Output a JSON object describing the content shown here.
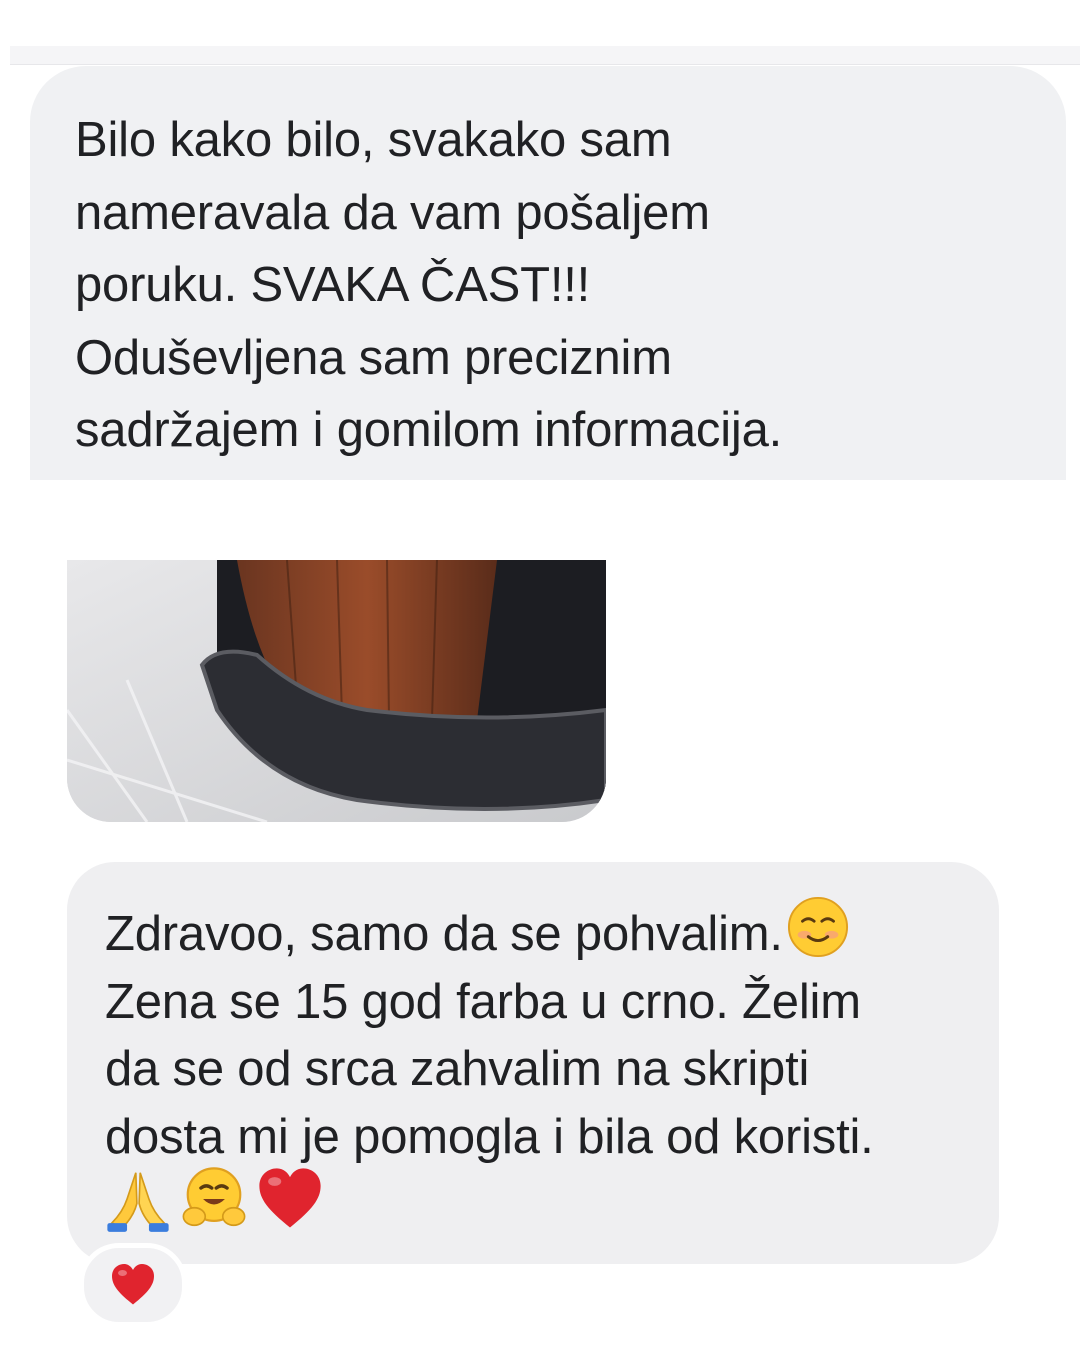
{
  "messages": [
    {
      "lines": [
        "Bilo kako bilo, svakako sam",
        "nameravala da vam pošaljem",
        "poruku. SVAKA ČAST!!!",
        "Oduševljena sam preciznim",
        "sadržajem i gomilom informacija."
      ]
    },
    {
      "lines": [
        "Zdravoo, samo da se pohvalim.",
        "Zena se 15 god farba u crno. Želim",
        "da se od srca zahvalim na skripti",
        "dosta mi je pomogla i bila od koristi."
      ],
      "inline_emoji": "smiling-face-icon",
      "emojis": [
        "folded-hands-icon",
        "hugging-face-icon",
        "red-heart-icon"
      ],
      "reaction": "red-heart-icon"
    }
  ],
  "colors": {
    "bubble_bg": "#f0f1f3",
    "text": "#202124",
    "heart": "#e0242e"
  }
}
